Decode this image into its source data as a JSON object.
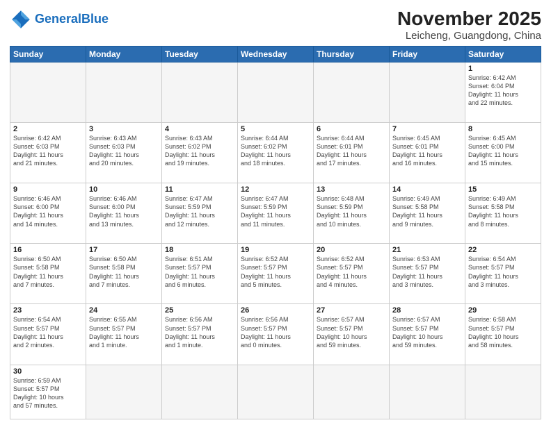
{
  "header": {
    "logo_general": "General",
    "logo_blue": "Blue",
    "month_title": "November 2025",
    "location": "Leicheng, Guangdong, China"
  },
  "weekdays": [
    "Sunday",
    "Monday",
    "Tuesday",
    "Wednesday",
    "Thursday",
    "Friday",
    "Saturday"
  ],
  "days": [
    {
      "num": "",
      "info": ""
    },
    {
      "num": "",
      "info": ""
    },
    {
      "num": "",
      "info": ""
    },
    {
      "num": "",
      "info": ""
    },
    {
      "num": "",
      "info": ""
    },
    {
      "num": "",
      "info": ""
    },
    {
      "num": "1",
      "info": "Sunrise: 6:42 AM\nSunset: 6:04 PM\nDaylight: 11 hours\nand 22 minutes."
    },
    {
      "num": "2",
      "info": "Sunrise: 6:42 AM\nSunset: 6:03 PM\nDaylight: 11 hours\nand 21 minutes."
    },
    {
      "num": "3",
      "info": "Sunrise: 6:43 AM\nSunset: 6:03 PM\nDaylight: 11 hours\nand 20 minutes."
    },
    {
      "num": "4",
      "info": "Sunrise: 6:43 AM\nSunset: 6:02 PM\nDaylight: 11 hours\nand 19 minutes."
    },
    {
      "num": "5",
      "info": "Sunrise: 6:44 AM\nSunset: 6:02 PM\nDaylight: 11 hours\nand 18 minutes."
    },
    {
      "num": "6",
      "info": "Sunrise: 6:44 AM\nSunset: 6:01 PM\nDaylight: 11 hours\nand 17 minutes."
    },
    {
      "num": "7",
      "info": "Sunrise: 6:45 AM\nSunset: 6:01 PM\nDaylight: 11 hours\nand 16 minutes."
    },
    {
      "num": "8",
      "info": "Sunrise: 6:45 AM\nSunset: 6:00 PM\nDaylight: 11 hours\nand 15 minutes."
    },
    {
      "num": "9",
      "info": "Sunrise: 6:46 AM\nSunset: 6:00 PM\nDaylight: 11 hours\nand 14 minutes."
    },
    {
      "num": "10",
      "info": "Sunrise: 6:46 AM\nSunset: 6:00 PM\nDaylight: 11 hours\nand 13 minutes."
    },
    {
      "num": "11",
      "info": "Sunrise: 6:47 AM\nSunset: 5:59 PM\nDaylight: 11 hours\nand 12 minutes."
    },
    {
      "num": "12",
      "info": "Sunrise: 6:47 AM\nSunset: 5:59 PM\nDaylight: 11 hours\nand 11 minutes."
    },
    {
      "num": "13",
      "info": "Sunrise: 6:48 AM\nSunset: 5:59 PM\nDaylight: 11 hours\nand 10 minutes."
    },
    {
      "num": "14",
      "info": "Sunrise: 6:49 AM\nSunset: 5:58 PM\nDaylight: 11 hours\nand 9 minutes."
    },
    {
      "num": "15",
      "info": "Sunrise: 6:49 AM\nSunset: 5:58 PM\nDaylight: 11 hours\nand 8 minutes."
    },
    {
      "num": "16",
      "info": "Sunrise: 6:50 AM\nSunset: 5:58 PM\nDaylight: 11 hours\nand 7 minutes."
    },
    {
      "num": "17",
      "info": "Sunrise: 6:50 AM\nSunset: 5:58 PM\nDaylight: 11 hours\nand 7 minutes."
    },
    {
      "num": "18",
      "info": "Sunrise: 6:51 AM\nSunset: 5:57 PM\nDaylight: 11 hours\nand 6 minutes."
    },
    {
      "num": "19",
      "info": "Sunrise: 6:52 AM\nSunset: 5:57 PM\nDaylight: 11 hours\nand 5 minutes."
    },
    {
      "num": "20",
      "info": "Sunrise: 6:52 AM\nSunset: 5:57 PM\nDaylight: 11 hours\nand 4 minutes."
    },
    {
      "num": "21",
      "info": "Sunrise: 6:53 AM\nSunset: 5:57 PM\nDaylight: 11 hours\nand 3 minutes."
    },
    {
      "num": "22",
      "info": "Sunrise: 6:54 AM\nSunset: 5:57 PM\nDaylight: 11 hours\nand 3 minutes."
    },
    {
      "num": "23",
      "info": "Sunrise: 6:54 AM\nSunset: 5:57 PM\nDaylight: 11 hours\nand 2 minutes."
    },
    {
      "num": "24",
      "info": "Sunrise: 6:55 AM\nSunset: 5:57 PM\nDaylight: 11 hours\nand 1 minute."
    },
    {
      "num": "25",
      "info": "Sunrise: 6:56 AM\nSunset: 5:57 PM\nDaylight: 11 hours\nand 1 minute."
    },
    {
      "num": "26",
      "info": "Sunrise: 6:56 AM\nSunset: 5:57 PM\nDaylight: 11 hours\nand 0 minutes."
    },
    {
      "num": "27",
      "info": "Sunrise: 6:57 AM\nSunset: 5:57 PM\nDaylight: 10 hours\nand 59 minutes."
    },
    {
      "num": "28",
      "info": "Sunrise: 6:57 AM\nSunset: 5:57 PM\nDaylight: 10 hours\nand 59 minutes."
    },
    {
      "num": "29",
      "info": "Sunrise: 6:58 AM\nSunset: 5:57 PM\nDaylight: 10 hours\nand 58 minutes."
    },
    {
      "num": "30",
      "info": "Sunrise: 6:59 AM\nSunset: 5:57 PM\nDaylight: 10 hours\nand 57 minutes."
    }
  ]
}
